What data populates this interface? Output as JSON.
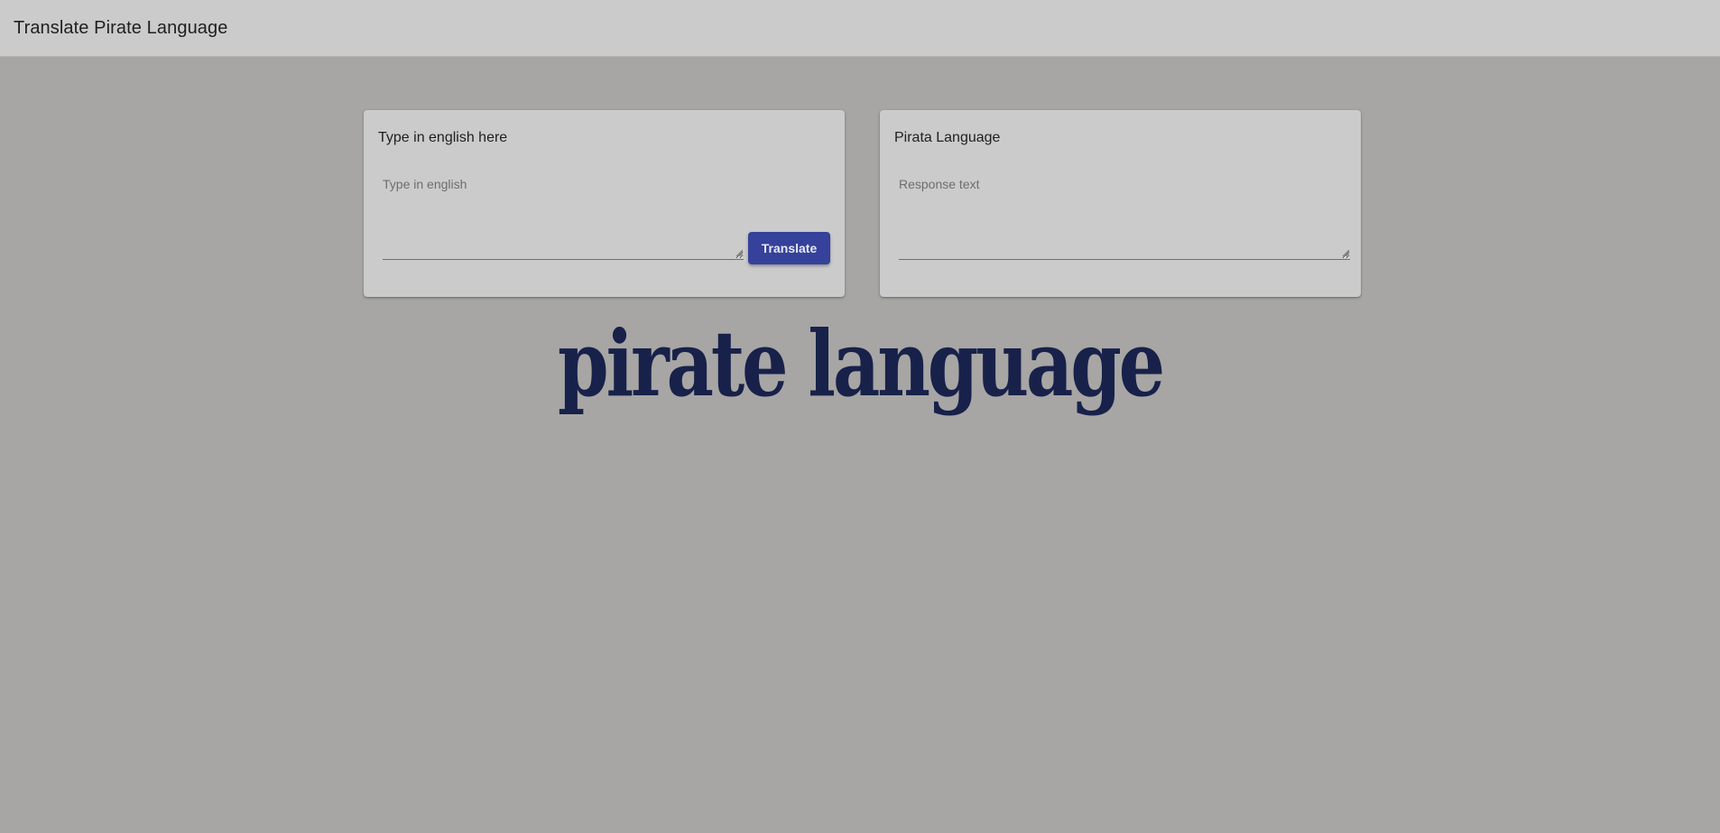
{
  "toolbar": {
    "title": "Translate Pirate Language"
  },
  "input_card": {
    "title": "Type in english here",
    "placeholder": "Type in english",
    "value": "",
    "button_label": "Translate"
  },
  "output_card": {
    "title": "Pirata Language",
    "placeholder": "Response text",
    "value": ""
  },
  "logo": {
    "text": "pirate language"
  },
  "colors": {
    "page_background": "#a7a6a4",
    "toolbar_background": "#cbcbcb",
    "card_background": "#cbcbcb",
    "button_background": "#35419a",
    "logo_color": "#18214a"
  },
  "icons": {
    "resize_handle": "resize-grip-icon"
  }
}
